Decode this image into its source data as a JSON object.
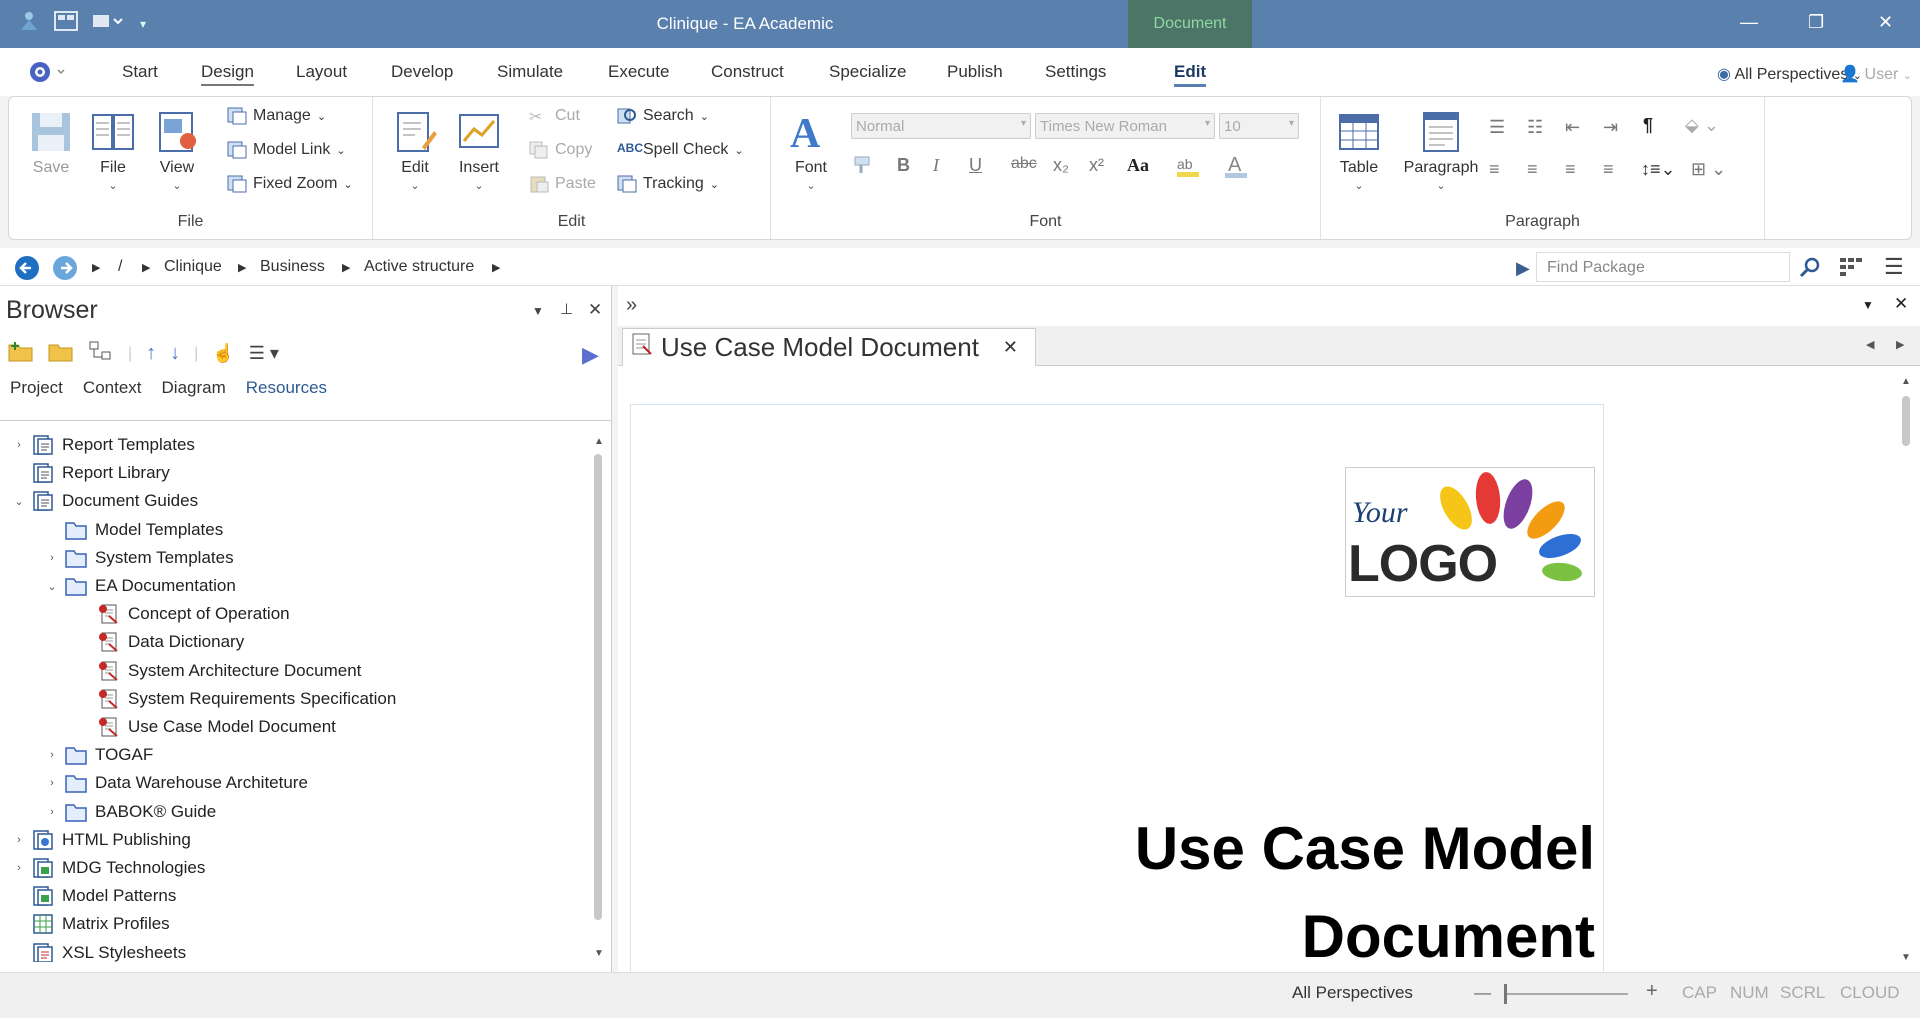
{
  "window": {
    "title": "Clinique - EA Academic",
    "context_tab": "Document",
    "minimize": "—",
    "restore": "❐",
    "close": "✕"
  },
  "menu": {
    "tabs": [
      "Start",
      "Design",
      "Layout",
      "Develop",
      "Simulate",
      "Execute",
      "Construct",
      "Specialize",
      "Publish",
      "Settings",
      "Edit"
    ],
    "perspectives": "All Perspectives",
    "user": "User"
  },
  "ribbon": {
    "file_group": {
      "label": "File",
      "save": "Save",
      "file": "File",
      "view": "View",
      "manage": "Manage",
      "model_link": "Model Link",
      "fixed_zoom": "Fixed Zoom"
    },
    "edit_group": {
      "label": "Edit",
      "edit": "Edit",
      "insert": "Insert",
      "cut": "Cut",
      "copy": "Copy",
      "paste": "Paste",
      "search": "Search",
      "spell_check": "Spell Check",
      "tracking": "Tracking"
    },
    "font_group": {
      "label": "Font",
      "font": "Font",
      "style": "Normal",
      "face": "Times New Roman",
      "size": "10",
      "bold": "B",
      "italic": "I",
      "underline": "U",
      "strike": "abc",
      "sub": "x₂",
      "sup": "x²",
      "case": "Aa"
    },
    "paragraph_group": {
      "label": "Paragraph",
      "table": "Table",
      "paragraph": "Paragraph",
      "pilcrow": "¶"
    }
  },
  "nav": {
    "root": "/",
    "crumbs": [
      "Clinique",
      "Business",
      "Active structure"
    ],
    "find_placeholder": "Find Package"
  },
  "browser": {
    "title": "Browser",
    "tabs": [
      "Project",
      "Context",
      "Diagram",
      "Resources"
    ],
    "active_tab": "Resources",
    "tree": [
      {
        "label": "Report Templates",
        "level": 0,
        "exp": "›",
        "icon": "doc"
      },
      {
        "label": "Report Library",
        "level": 0,
        "exp": "",
        "icon": "doc"
      },
      {
        "label": "Document Guides",
        "level": 0,
        "exp": "⌄",
        "icon": "doc"
      },
      {
        "label": "Model Templates",
        "level": 1,
        "exp": "",
        "icon": "folder"
      },
      {
        "label": "System Templates",
        "level": 1,
        "exp": "›",
        "icon": "folder"
      },
      {
        "label": "EA Documentation",
        "level": 1,
        "exp": "⌄",
        "icon": "folder"
      },
      {
        "label": "Concept of Operation",
        "level": 2,
        "exp": "",
        "icon": "report"
      },
      {
        "label": "Data Dictionary",
        "level": 2,
        "exp": "",
        "icon": "report"
      },
      {
        "label": "System Architecture Document",
        "level": 2,
        "exp": "",
        "icon": "report"
      },
      {
        "label": "System Requirements Specification",
        "level": 2,
        "exp": "",
        "icon": "report"
      },
      {
        "label": "Use Case Model Document",
        "level": 2,
        "exp": "",
        "icon": "report"
      },
      {
        "label": "TOGAF",
        "level": 1,
        "exp": "›",
        "icon": "folder"
      },
      {
        "label": "Data Warehouse Architeture",
        "level": 1,
        "exp": "›",
        "icon": "folder"
      },
      {
        "label": "BABOK® Guide",
        "level": 1,
        "exp": "›",
        "icon": "folder"
      },
      {
        "label": "HTML Publishing",
        "level": 0,
        "exp": "›",
        "icon": "html"
      },
      {
        "label": "MDG Technologies",
        "level": 0,
        "exp": "›",
        "icon": "mdg"
      },
      {
        "label": "Model Patterns",
        "level": 0,
        "exp": "",
        "icon": "mdg"
      },
      {
        "label": "Matrix Profiles",
        "level": 0,
        "exp": "",
        "icon": "matrix"
      },
      {
        "label": "XSL Stylesheets",
        "level": 0,
        "exp": "",
        "icon": "xsl"
      }
    ]
  },
  "document": {
    "tab_label": "Use Case Model Document",
    "logo_your": "Your",
    "logo_word": "LOGO",
    "title_line1": "Use Case Model",
    "title_line2": "Document"
  },
  "status": {
    "perspectives": "All Perspectives",
    "minus": "—",
    "plus": "+",
    "cap": "CAP",
    "num": "NUM",
    "scrl": "SCRL",
    "cloud": "CLOUD"
  },
  "colors": {
    "titlebar": "#5a80ae",
    "accent": "#2e5a94",
    "context_tab": "#4d7567"
  }
}
